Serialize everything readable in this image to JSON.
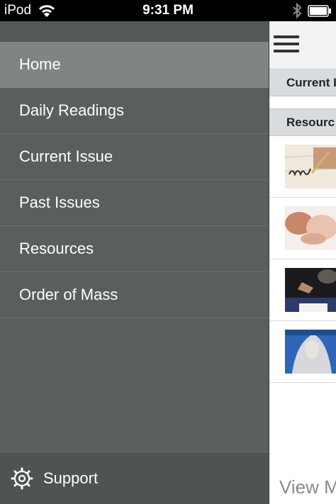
{
  "status_bar": {
    "carrier": "iPod",
    "time": "9:31 PM"
  },
  "drawer": {
    "items": [
      {
        "label": "Home",
        "selected": true
      },
      {
        "label": "Daily Readings",
        "selected": false
      },
      {
        "label": "Current Issue",
        "selected": false
      },
      {
        "label": "Past Issues",
        "selected": false
      },
      {
        "label": "Resources",
        "selected": false
      },
      {
        "label": "Order of Mass",
        "selected": false
      }
    ],
    "footer": {
      "label": "Support",
      "icon": "gear-icon"
    }
  },
  "main": {
    "sections": [
      "Current I",
      "Resourc"
    ],
    "thumbnails": [
      {
        "icon": "handwriting-why-image"
      },
      {
        "icon": "baby-hands-image"
      },
      {
        "icon": "praying-hands-image"
      },
      {
        "icon": "mary-statue-image"
      }
    ],
    "view_more": "View M"
  },
  "colors": {
    "drawer_bg": "#5a5e5f",
    "drawer_selected": "#808485",
    "section_header_bg": "#d9dcdf"
  }
}
